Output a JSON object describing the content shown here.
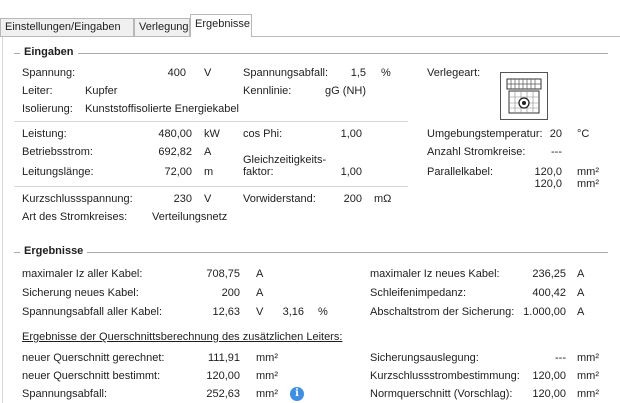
{
  "tabs": [
    "Einstellungen/Eingaben",
    "Verlegung",
    "Ergebnisse"
  ],
  "eingaben": {
    "title": "Eingaben",
    "spannung_label": "Spannung:",
    "spannung_value": "400",
    "spannung_unit": "V",
    "spannungsabfall_label": "Spannungsabfall:",
    "spannungsabfall_value": "1,5",
    "spannungsabfall_unit": "%",
    "verlegeart_label": "Verlegeart:",
    "leiter_label": "Leiter:",
    "leiter_value": "Kupfer",
    "kennlinie_label": "Kennlinie:",
    "kennlinie_value": "gG (NH)",
    "isolierung_label": "Isolierung:",
    "isolierung_value": "Kunststoffisolierte Energiekabel",
    "leistung_label": "Leistung:",
    "leistung_value": "480,00",
    "leistung_unit": "kW",
    "cosphi_label": "cos Phi:",
    "cosphi_value": "1,00",
    "umgebung_label": "Umgebungstemperatur:",
    "umgebung_value": "20",
    "umgebung_unit": "°C",
    "betriebsstrom_label": "Betriebsstrom:",
    "betriebsstrom_value": "692,82",
    "betriebsstrom_unit": "A",
    "gleichzeitig_label_1": "Gleichzeitigkeits-",
    "gleichzeitig_label_2": "faktor:",
    "gleichzeitig_value": "1,00",
    "anzahl_label": "Anzahl Stromkreise:",
    "anzahl_value": "---",
    "leitungslaenge_label": "Leitungslänge:",
    "leitungslaenge_value": "72,00",
    "leitungslaenge_unit": "m",
    "parallel_label": "Parallelkabel:",
    "parallel_value_1": "120,0",
    "parallel_unit_1": "mm²",
    "parallel_value_2": "120,0",
    "parallel_unit_2": "mm²",
    "kurzschluss_label": "Kurzschlussspannung:",
    "kurzschluss_value": "230",
    "kurzschluss_unit": "V",
    "vorwiderstand_label": "Vorwiderstand:",
    "vorwiderstand_value": "200",
    "vorwiderstand_unit": "mΩ",
    "stromkreis_label": "Art des Stromkreises:",
    "stromkreis_value": "Verteilungsnetz"
  },
  "ergebnisse": {
    "title": "Ergebnisse",
    "max_iz_label": "maximaler Iz aller Kabel:",
    "max_iz_value": "708,75",
    "max_iz_unit": "A",
    "max_iz_neu_label": "maximaler Iz neues Kabel:",
    "max_iz_neu_value": "236,25",
    "max_iz_neu_unit": "A",
    "sicherung_label": "Sicherung neues Kabel:",
    "sicherung_value": "200",
    "sicherung_unit": "A",
    "schleife_label": "Schleifenimpedanz:",
    "schleife_value": "400,42",
    "schleife_unit": "A",
    "abfall_alle_label": "Spannungsabfall aller Kabel:",
    "abfall_alle_value": "12,63",
    "abfall_alle_unit": "V",
    "abfall_alle_pct": "3,16",
    "abfall_alle_pct_unit": "%",
    "abschalt_label": "Abschaltstrom der Sicherung:",
    "abschalt_value": "1.000,00",
    "abschalt_unit": "A",
    "zusatz_heading": "Ergebnisse der Querschnittsberechnung des zusätzlichen Leiters:",
    "neu_ger_label": "neuer Querschnitt gerechnet:",
    "neu_ger_value": "111,91",
    "neu_ger_unit": "mm²",
    "sich_ausl_label": "Sicherungsauslegung:",
    "sich_ausl_value": "---",
    "sich_ausl_unit": "mm²",
    "neu_best_label": "neuer Querschnitt bestimmt:",
    "neu_best_value": "120,00",
    "neu_best_unit": "mm²",
    "ks_best_label": "Kurzschlussstrombestimmung:",
    "ks_best_value": "120,00",
    "ks_best_unit": "mm²",
    "sp_abfall_label": "Spannungsabfall:",
    "sp_abfall_value": "252,63",
    "sp_abfall_unit": "mm²",
    "norm_label": "Normquerschnitt (Vorschlag):",
    "norm_value": "120,00",
    "norm_unit": "mm²"
  },
  "colors": {
    "info_icon": "#3c8ee6",
    "section_line": "#a9a9a9"
  },
  "icons": {
    "verlegeart": "cable-laying-icon",
    "info": "info-icon"
  }
}
